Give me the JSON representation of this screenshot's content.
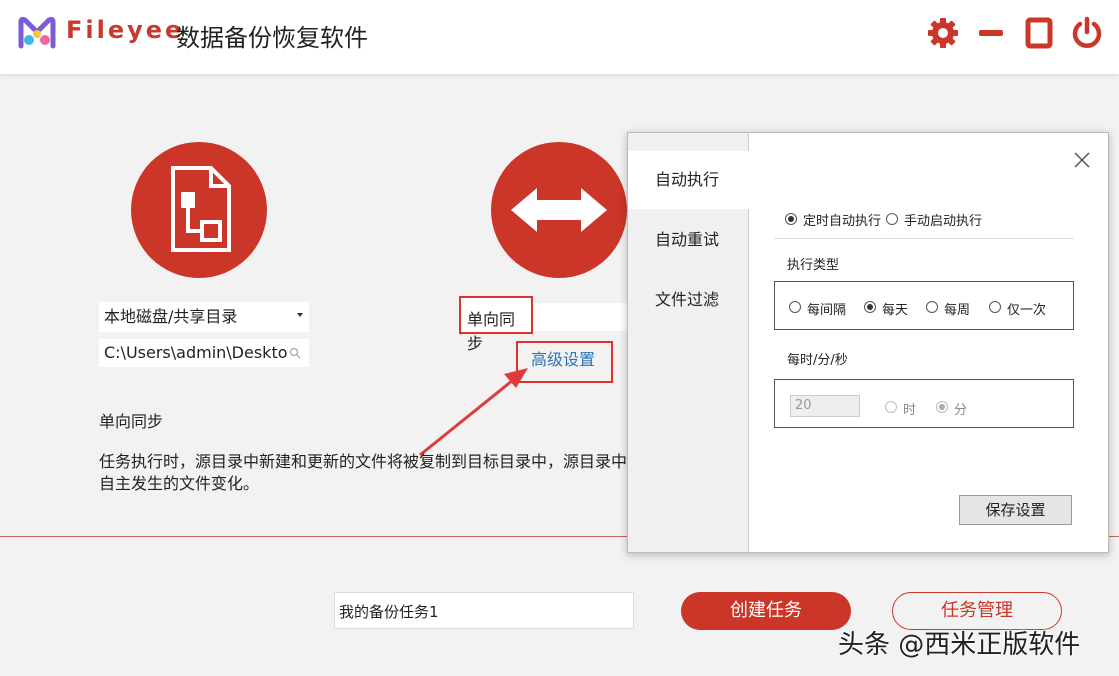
{
  "header": {
    "brand": "Fileyee",
    "title": "数据备份恢复软件",
    "icons": [
      "gear-icon",
      "minimize-icon",
      "maximize-icon",
      "power-icon"
    ],
    "accent_color": "#cc3629"
  },
  "source": {
    "type_select": "本地磁盘/共享目录",
    "path": "C:\\Users\\admin\\Deskto"
  },
  "mode": {
    "select": "单向同步",
    "advanced_link": "高级设置"
  },
  "description": {
    "title": "单向同步",
    "text": "任务执行时，源目录中新建和更新的文件将被复制到目标目录中，源目录中自主发生的文件变化。"
  },
  "bottom": {
    "task_name": "我的备份任务1",
    "create_button": "创建任务",
    "manage_button": "任务管理"
  },
  "watermark": "头条 @西米正版软件",
  "dialog": {
    "tabs": [
      "自动执行",
      "自动重试",
      "文件过滤"
    ],
    "exec_options": [
      "定时自动执行",
      "手动启动执行"
    ],
    "exec_type_label": "执行类型",
    "exec_types": [
      "每间隔",
      "每天",
      "每周",
      "仅一次"
    ],
    "time_label": "每时/分/秒",
    "time_value": "20",
    "time_units": [
      "时",
      "分"
    ],
    "save_button": "保存设置"
  }
}
